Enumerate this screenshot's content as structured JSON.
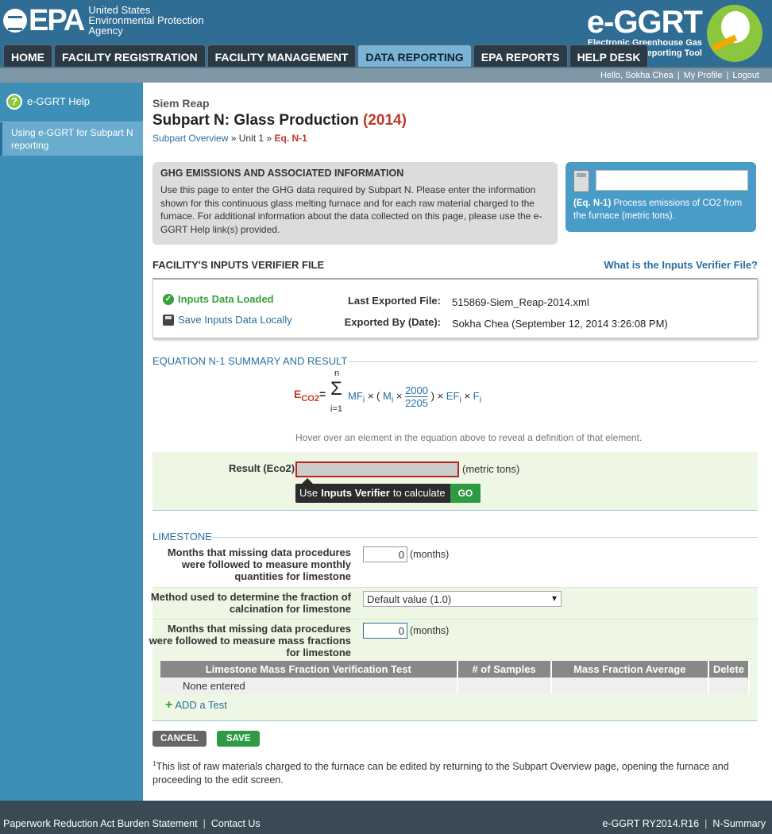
{
  "header": {
    "epa_logo": "EPA",
    "epa_sub": [
      "United States",
      "Environmental Protection",
      "Agency"
    ],
    "eggrt_title": "e-GGRT",
    "eggrt_sub": [
      "Electronic Greenhouse Gas",
      "Reporting Tool"
    ]
  },
  "nav": {
    "tabs": [
      {
        "label": "HOME"
      },
      {
        "label": "FACILITY REGISTRATION"
      },
      {
        "label": "FACILITY MANAGEMENT"
      },
      {
        "label": "DATA REPORTING"
      },
      {
        "label": "EPA REPORTS"
      },
      {
        "label": "HELP DESK"
      }
    ]
  },
  "userbar": {
    "greeting": "Hello, Sokha Chea",
    "profile": "My Profile",
    "logout": "Logout"
  },
  "sidebar": {
    "help": "e-GGRT Help",
    "link": "Using e-GGRT for Subpart N reporting"
  },
  "page": {
    "facility": "Siem Reap",
    "title": "Subpart N: Glass Production",
    "year": "(2014)",
    "crumb_overview": "Subpart Overview",
    "crumb_sep1": "»",
    "crumb_unit": "Unit 1",
    "crumb_sep2": "»",
    "crumb_current": "Eq. N-1"
  },
  "ghg": {
    "heading": "GHG EMISSIONS AND ASSOCIATED INFORMATION",
    "text": "Use this page to enter the GHG data required by Subpart N. Please enter the information shown for this continuous glass melting furnace and for each raw material charged to the furnace. For additional information about the data collected on this page, please use the e-GGRT Help link(s) provided."
  },
  "calc": {
    "bold": "(Eq. N-1)",
    "text": " Process emissions of CO2 from the furnace (metric tons)."
  },
  "verifier": {
    "heading": "FACILITY'S INPUTS VERIFIER FILE",
    "link": "What is the Inputs Verifier File?",
    "loaded": "Inputs Data Loaded",
    "save": "Save Inputs Data Locally",
    "last_label": "Last Exported File:",
    "last_value": "515869-Siem_Reap-2014.xml",
    "by_label": "Exported By (Date):",
    "by_value": "Sokha Chea (September 12, 2014 3:26:08 PM)"
  },
  "equation": {
    "section": "EQUATION N-1 SUMMARY AND RESULT",
    "lhs": "E",
    "lhs_sub": "CO2",
    "sum_top": "n",
    "sum_bottom": "i=1",
    "sum_sign": "Σ",
    "mf": "MF",
    "m": "M",
    "frac_num": "2000",
    "frac_den": "2205",
    "ef": "EF",
    "f": "F",
    "hover_note": "Hover over an element in the equation above to reveal a definition of that element.",
    "result_label": "Result (Eco2)",
    "result_unit": "(metric tons)",
    "verify_pre": "Use",
    "verify_bold": "Inputs Verifier",
    "verify_post": "to calculate",
    "go": "GO"
  },
  "limestone": {
    "section": "LIMESTONE",
    "q1": "Months that missing data procedures were followed to measure monthly quantities for limestone",
    "q1_value": "0",
    "q1_unit": "(months)",
    "q2": "Method used to determine the fraction of calcination for limestone",
    "q2_value": "Default value (1.0)",
    "q3": "Months that missing data procedures were followed to measure mass fractions for limestone",
    "q3_value": "0",
    "q3_unit": "(months)",
    "table_headers": [
      "Limestone Mass Fraction Verification Test",
      "# of Samples",
      "Mass Fraction Average",
      "Delete"
    ],
    "table_empty": "None entered",
    "add_test": "ADD a Test"
  },
  "buttons": {
    "cancel": "CANCEL",
    "save": "SAVE"
  },
  "footnote": {
    "sup": "1",
    "text": "This list of raw materials charged to the furnace can be edited by returning to the Subpart Overview page, opening the furnace and proceeding to the edit screen."
  },
  "footer": {
    "paperwork": "Paperwork Reduction Act Burden Statement",
    "contact": "Contact Us",
    "version": "e-GGRT RY2014.R16",
    "page_id": "N-Summary"
  }
}
